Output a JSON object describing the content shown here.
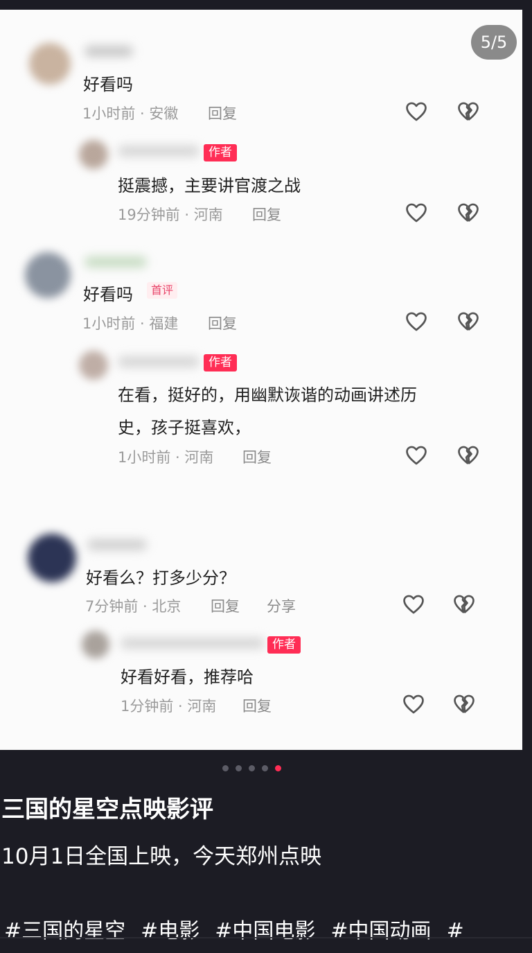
{
  "image_counter": "5/5",
  "comments": [
    {
      "text": "好看吗",
      "time": "1小时前",
      "location": "安徽",
      "reply": "回复",
      "reply_item": {
        "badge": "作者",
        "text": "挺震撼，主要讲官渡之战",
        "time": "19分钟前",
        "location": "河南",
        "reply": "回复"
      }
    },
    {
      "text": "好看吗",
      "badge": "首评",
      "time": "1小时前",
      "location": "福建",
      "reply": "回复",
      "reply_item": {
        "badge": "作者",
        "text_line1": "在看，挺好的，用幽默诙谐的动画讲述历",
        "text_line2": "史，孩子挺喜欢，",
        "time": "1小时前",
        "location": "河南",
        "reply": "回复"
      }
    },
    {
      "text": "好看么？打多少分？",
      "time": "7分钟前",
      "location": "北京",
      "reply": "回复",
      "share": "分享",
      "reply_item": {
        "badge": "作者",
        "text": "好看好看，推荐哈",
        "time": "1分钟前",
        "location": "河南",
        "reply": "回复"
      }
    }
  ],
  "meta_separator": " · ",
  "icons": {
    "like": "heart-icon",
    "dislike": "broken-heart-icon"
  },
  "carousel": {
    "count": 5,
    "active_index": 4
  },
  "post": {
    "title": "三国的星空点映影评",
    "description": "10月1日全国上映，今天郑州点映",
    "tags": [
      "#三国的星空",
      "#电影",
      "#中国电影",
      "#中国动画",
      "#"
    ]
  },
  "colors": {
    "accent": "#ff2d55",
    "background": "#1c1c24"
  }
}
